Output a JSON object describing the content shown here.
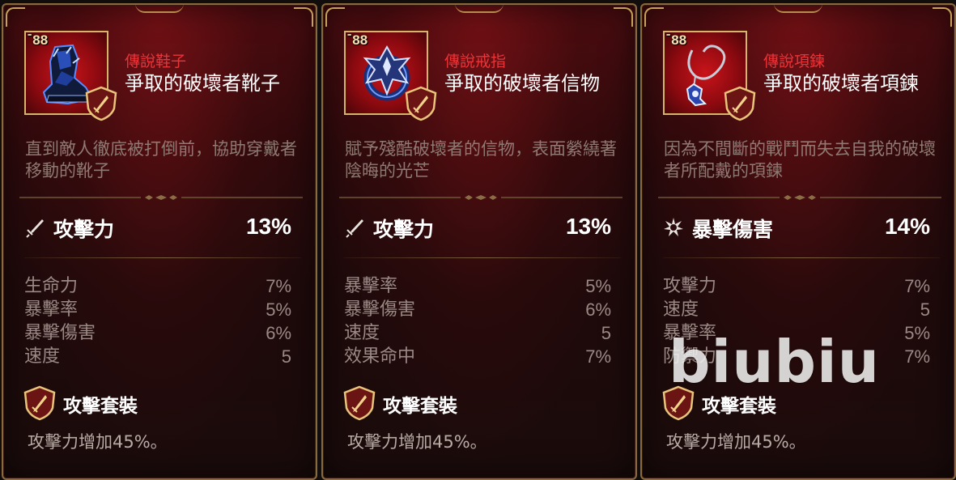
{
  "cards": [
    {
      "level": "88",
      "rarity": "傳說鞋子",
      "name": "爭取的破壞者靴子",
      "description": "直到敵人徹底被打倒前，協助穿戴者移動的靴子",
      "main_stat": {
        "label": "攻擊力",
        "value": "13%",
        "icon": "sword-icon"
      },
      "sub_stats": [
        {
          "label": "生命力",
          "value": "7%"
        },
        {
          "label": "暴擊率",
          "value": "5%"
        },
        {
          "label": "暴擊傷害",
          "value": "6%"
        },
        {
          "label": "速度",
          "value": "5"
        }
      ],
      "set": {
        "name": "攻擊套裝",
        "effect": "攻擊力增加45%。"
      }
    },
    {
      "level": "88",
      "rarity": "傳說戒指",
      "name": "爭取的破壞者信物",
      "description": "賦予殘酷破壞者的信物，表面縈繞著陰晦的光芒",
      "main_stat": {
        "label": "攻擊力",
        "value": "13%",
        "icon": "sword-icon"
      },
      "sub_stats": [
        {
          "label": "暴擊率",
          "value": "5%"
        },
        {
          "label": "暴擊傷害",
          "value": "6%"
        },
        {
          "label": "速度",
          "value": "5"
        },
        {
          "label": "效果命中",
          "value": "7%"
        }
      ],
      "set": {
        "name": "攻擊套裝",
        "effect": "攻擊力增加45%。"
      }
    },
    {
      "level": "88",
      "rarity": "傳說項鍊",
      "name": "爭取的破壞者項鍊",
      "description": "因為不間斷的戰鬥而失去自我的破壞者所配戴的項鍊",
      "main_stat": {
        "label": "暴擊傷害",
        "value": "14%",
        "icon": "crit-burst-icon"
      },
      "sub_stats": [
        {
          "label": "攻擊力",
          "value": "7%"
        },
        {
          "label": "速度",
          "value": "5"
        },
        {
          "label": "暴擊率",
          "value": "5%"
        },
        {
          "label": "防禦力",
          "value": "7%"
        }
      ],
      "set": {
        "name": "攻擊套裝",
        "effect": "攻擊力增加45%。"
      }
    }
  ],
  "watermark": "biubiu",
  "colors": {
    "rarity": "#e8353a",
    "gold_border": "#c7a05a",
    "item_bg": "#c8141a",
    "desc": "#8e7a72",
    "sub_stat": "#9a8985"
  }
}
